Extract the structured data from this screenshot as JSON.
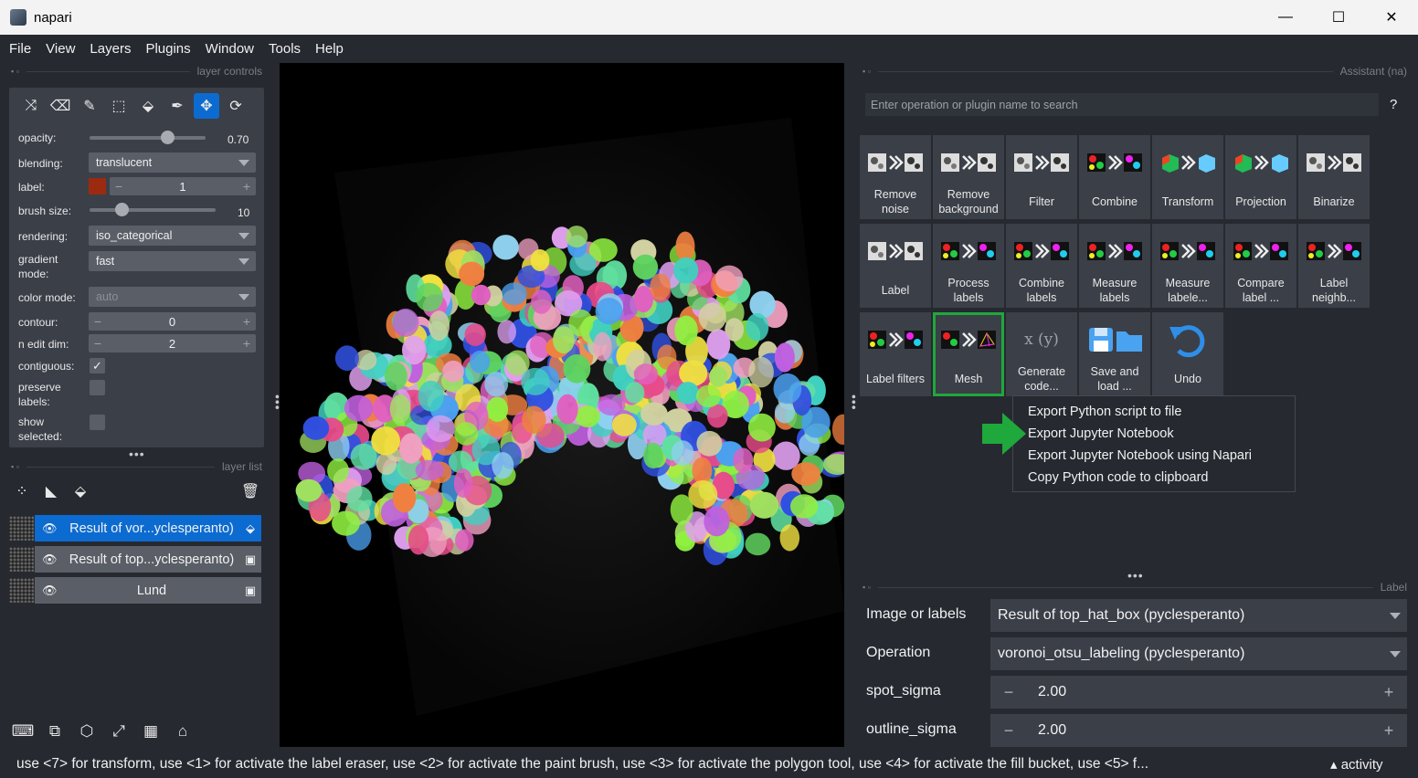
{
  "window": {
    "title": "napari",
    "minimize": "—",
    "maximize": "☐",
    "close": "✕"
  },
  "menu": [
    "File",
    "View",
    "Layers",
    "Plugins",
    "Window",
    "Tools",
    "Help"
  ],
  "layer_controls": {
    "header": "layer controls",
    "tools": [
      "⤨",
      "⌫",
      "✎",
      "⬚",
      "⬙",
      "✒",
      "✥",
      "⟳"
    ],
    "opacity": {
      "label": "opacity:",
      "value": "0.70",
      "fraction": 0.7
    },
    "blending": {
      "label": "blending:",
      "value": "translucent"
    },
    "label": {
      "label": "label:",
      "value": "1",
      "minus": "−",
      "plus": "+",
      "color": "#9b2a10"
    },
    "brush_size": {
      "label": "brush size:",
      "value": "10",
      "fraction": 0.3
    },
    "rendering": {
      "label": "rendering:",
      "value": "iso_categorical"
    },
    "gradient_mode": {
      "label": "gradient\nmode:",
      "value": "fast"
    },
    "color_mode": {
      "label": "color mode:",
      "value": "auto"
    },
    "contour": {
      "label": "contour:",
      "value": "0",
      "minus": "−",
      "plus": "+"
    },
    "n_edit_dim": {
      "label": "n edit dim:",
      "value": "2",
      "minus": "−",
      "plus": "+"
    },
    "contiguous": {
      "label": "contiguous:",
      "checked": "✓"
    },
    "preserve_labels": {
      "label": "preserve\nlabels:"
    },
    "show_selected": {
      "label": "show\nselected:"
    }
  },
  "layer_list": {
    "header": "layer list",
    "layers": [
      {
        "name": "Result of vor...yclesperanto)",
        "eye": "👁",
        "type": "⬙"
      },
      {
        "name": "Result of top...yclesperanto)",
        "eye": "👁",
        "type": "▣"
      },
      {
        "name": "Lund",
        "eye": "👁",
        "type": "▣"
      }
    ]
  },
  "assistant": {
    "header": "Assistant (na)",
    "search_placeholder": "Enter operation or plugin name to search",
    "help": "?",
    "tiles": [
      "Remove\nnoise",
      "Remove\nbackground",
      "Filter",
      "Combine",
      "Transform",
      "Projection",
      "Binarize",
      "Label",
      "Process\nlabels",
      "Combine\nlabels",
      "Measure\nlabels",
      "Measure\nlabele...",
      "Compare\nlabel ...",
      "Label\nneighb...",
      "Label filters",
      "Mesh",
      "Generate\ncode...",
      "Save and\nload ...",
      "Undo"
    ]
  },
  "context_menu": [
    "Export Python script to file",
    "Export Jupyter Notebook",
    "Export Jupyter Notebook using Napari",
    "Copy Python code to clipboard"
  ],
  "label_panel": {
    "header": "Label",
    "image_or_labels": {
      "label": "Image or labels",
      "value": "Result of top_hat_box (pyclesperanto)"
    },
    "operation": {
      "label": "Operation",
      "value": "voronoi_otsu_labeling (pyclesperanto)"
    },
    "spot_sigma": {
      "label": "spot_sigma",
      "value": "2.00"
    },
    "outline_sigma": {
      "label": "outline_sigma",
      "value": "2.00"
    },
    "minus": "−",
    "plus": "+"
  },
  "status_bar": {
    "text": "use <7> for transform, use <1> for activate the label eraser, use <2> for activate the paint brush, use <3> for activate the polygon tool, use <4> for activate the fill bucket, use <5> f...",
    "activity": "▴ activity"
  },
  "colors": {
    "accent": "#0c6bd0",
    "highlight": "#1fa83c",
    "panel": "#3b3f48",
    "bg": "#262930"
  }
}
